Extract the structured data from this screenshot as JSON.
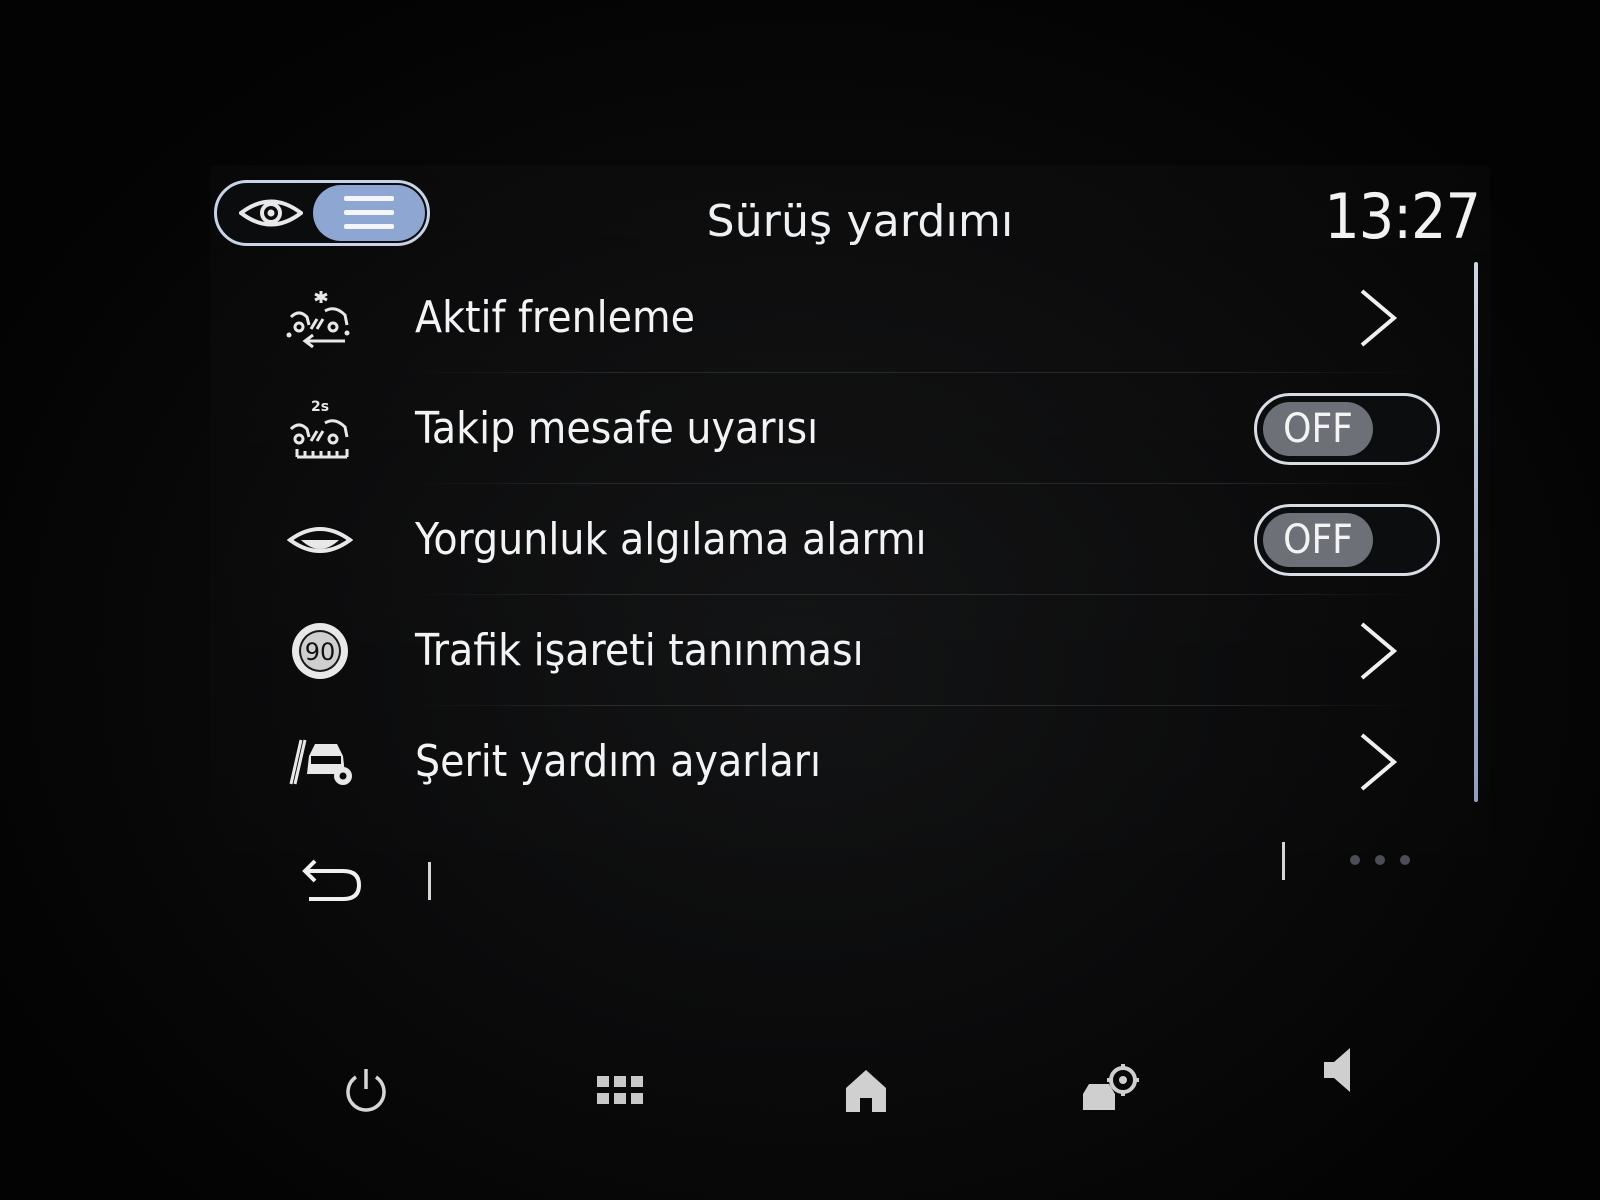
{
  "header": {
    "title": "Sürüş yardımı",
    "clock": "13:27",
    "view_toggle": {
      "left_icon": "eye-icon",
      "right_icon": "list-icon",
      "selected": "list"
    }
  },
  "items": [
    {
      "label": "Aktif frenleme",
      "icon": "active-braking-icon",
      "control": "chevron"
    },
    {
      "label": "Takip mesafe uyarısı",
      "icon": "distance-warning-icon",
      "control": "switch",
      "state": "OFF"
    },
    {
      "label": "Yorgunluk algılama alarmı",
      "icon": "fatigue-eye-icon",
      "control": "switch",
      "state": "OFF"
    },
    {
      "label": "Trafik işareti tanınması",
      "icon": "speed-sign-icon",
      "control": "chevron",
      "sign_value": "90"
    },
    {
      "label": "Şerit yardım ayarları",
      "icon": "lane-assist-icon",
      "control": "chevron"
    }
  ],
  "footer": {
    "back_icon": "back-arrow-icon",
    "more_icon": "more-dots-icon"
  },
  "hardware_bar": [
    "power-icon",
    "apps-grid-icon",
    "home-icon",
    "vehicle-settings-icon",
    "volume-icon"
  ],
  "colors": {
    "accent": "#8ea6d2",
    "switch_knob": "#6d7076",
    "text": "#f1f3f5"
  }
}
